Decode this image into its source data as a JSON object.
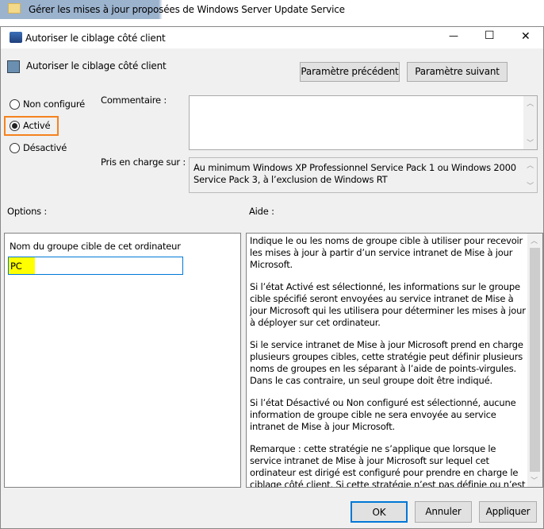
{
  "background": {
    "title": "Gérer les mises à jour proposées de Windows Server Update Service"
  },
  "window": {
    "title": "Autoriser le ciblage côté client",
    "minimize": "—",
    "maximize": "☐",
    "close": "✕"
  },
  "header": {
    "policy_name": "Autoriser le ciblage côté client",
    "prev_button": "Paramètre précédent",
    "next_button": "Paramètre suivant"
  },
  "state": {
    "options": [
      {
        "label": "Non configuré",
        "selected": false
      },
      {
        "label": "Activé",
        "selected": true
      },
      {
        "label": "Désactivé",
        "selected": false
      }
    ]
  },
  "comment": {
    "label": "Commentaire :",
    "value": ""
  },
  "supported": {
    "label": "Pris en charge sur :",
    "value": "Au minimum Windows XP Professionnel Service Pack 1 ou Windows 2000 Service Pack 3, à l’exclusion de Windows RT"
  },
  "options_label": "Options :",
  "help_label": "Aide :",
  "options_panel": {
    "field_label": "Nom du groupe cible de cet ordinateur",
    "field_value": "PC"
  },
  "help_text": [
    "Indique le ou les noms de groupe cible à utiliser pour recevoir les mises à jour à partir d’un service intranet de Mise à jour Microsoft.",
    "Si l’état Activé est sélectionné, les informations sur le groupe cible spécifié seront envoyées au service intranet de Mise à jour Microsoft qui les utilisera pour déterminer les mises à jour à déployer sur cet ordinateur.",
    "Si le service intranet de Mise à jour Microsoft prend en charge plusieurs groupes cibles, cette stratégie peut définir plusieurs noms de groupes en les séparant à l’aide de points-virgules. Dans le cas contraire, un seul groupe doit être indiqué.",
    "Si l’état Désactivé ou Non configuré est sélectionné, aucune information de groupe cible ne sera envoyée au service intranet de Mise à jour Microsoft.",
    "Remarque : cette stratégie ne s’applique que lorsque le service intranet de Mise à jour Microsoft sur lequel cet ordinateur est dirigé est configuré pour prendre en charge le ciblage côté client. Si cette stratégie n’est pas définie ou n’est pas configurée, aucune"
  ],
  "footer": {
    "ok": "OK",
    "cancel": "Annuler",
    "apply": "Appliquer"
  },
  "colors": {
    "highlight_orange": "#f5821f",
    "highlight_yellow": "#ffff00",
    "focus_blue": "#0078d7"
  }
}
